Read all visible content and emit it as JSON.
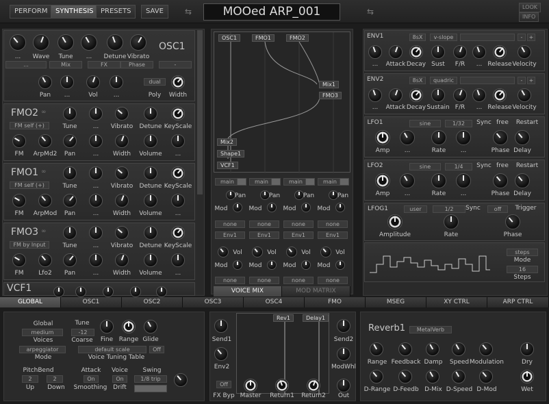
{
  "top": {
    "perform": "PERFORM",
    "synthesis": "SYNTHESIS",
    "presets": "PRESETS",
    "save": "SAVE",
    "preset_name": "MOOed ARP_001",
    "look": "LOOK",
    "info": "INFO"
  },
  "osc1": {
    "title": "OSC1",
    "labels": [
      "...",
      "Wave",
      "Tune",
      "...",
      "Detune",
      "Vibrato"
    ],
    "fields": [
      "...",
      "Mix",
      "FX",
      "Phase",
      "-"
    ],
    "r2": [
      "Pan",
      "...",
      "Vol",
      "...",
      "Poly",
      "Width"
    ],
    "poly": "dual"
  },
  "fmo2": {
    "title": "FMO2",
    "mode": "FM self (+)",
    "r1": [
      "Tune",
      "...",
      "Vibrato",
      "Detune",
      "KeyScale"
    ],
    "r2": [
      "FM",
      "ArpMd2",
      "Pan",
      "...",
      "Width",
      "Volume",
      "..."
    ]
  },
  "fmo1": {
    "title": "FMO1",
    "mode": "FM self (+)",
    "r1": [
      "Tune",
      "...",
      "Vibrato",
      "Detune",
      "KeyScale"
    ],
    "r2": [
      "FM",
      "ArpMod",
      "Pan",
      "...",
      "Width",
      "Volume",
      "..."
    ]
  },
  "fmo3": {
    "title": "FMO3",
    "mode": "FM by Input",
    "r1": [
      "Tune",
      "...",
      "Vibrato",
      "Detune",
      "KeyScale"
    ],
    "r2": [
      "FM",
      "Lfo2",
      "Pan",
      "...",
      "Width",
      "Volume",
      "..."
    ]
  },
  "vcf1": {
    "title": "VCF1"
  },
  "matrix": {
    "top": [
      "OSC1",
      "FMO1",
      "FMO2"
    ],
    "right": [
      "Mix1",
      "FMO3"
    ],
    "left": [
      "Mix2",
      "Shape1",
      "VCF1"
    ],
    "main": [
      "main",
      "main",
      "main",
      "main"
    ],
    "pan": "Pan",
    "mod": "Mod",
    "vol": "Vol",
    "none": "none",
    "env": "Env1",
    "voice_mix": "VOICE MIX",
    "mod_matrix": "MOD MATRIX"
  },
  "env1": {
    "title": "ENV1",
    "rate": "8sX",
    "shape": "v-slope",
    "labels": [
      "...",
      "Attack",
      "Decay",
      "Sust",
      "F/R",
      "...",
      "Release",
      "Velocity"
    ]
  },
  "env2": {
    "title": "ENV2",
    "rate": "8sX",
    "shape": "quadric",
    "labels": [
      "...",
      "Attack",
      "Decay",
      "Sustain",
      "F/R",
      "...",
      "Release",
      "Velocity"
    ]
  },
  "lfo1": {
    "title": "LFO1",
    "wave": "sine",
    "rate": "1/32",
    "sync": "Sync",
    "free": "free",
    "restart": "Restart",
    "labels": [
      "Amp",
      "...",
      "Rate",
      "...",
      "Phase",
      "Delay"
    ]
  },
  "lfo2": {
    "title": "LFO2",
    "wave": "sine",
    "rate": "1/4",
    "sync": "Sync",
    "free": "free",
    "restart": "Restart",
    "labels": [
      "Amp",
      "...",
      "Rate",
      "...",
      "Phase",
      "Delay"
    ]
  },
  "lfog1": {
    "title": "LFOG1",
    "wave": "user",
    "rate": "1/2",
    "sync": "Sync",
    "off": "off",
    "trigger": "Trigger",
    "labels": [
      "Amplitude",
      "Rate",
      "Phase"
    ],
    "steps": "steps",
    "mode": "Mode",
    "steps_val": "16",
    "steps_lbl": "Steps"
  },
  "tabs": [
    "GLOBAL",
    "OSC1",
    "OSC2",
    "OSC3",
    "OSC4",
    "FMO",
    "MSEG",
    "XY CTRL",
    "ARP CTRL"
  ],
  "global": {
    "global": "Global",
    "quality": "medium",
    "voices": "Voices",
    "mode_val": "arpeggiator",
    "mode": "Mode",
    "tune": "Tune",
    "coarse_val": "-12",
    "coarse": "Coarse",
    "fine": "Fine",
    "range": "Range",
    "glide": "Glide",
    "scale": "default scale",
    "off": "Off",
    "vtt": "Voice Tuning Table",
    "pitchbend": "PitchBend",
    "up_val": "2",
    "down_val": "2",
    "up": "Up",
    "down": "Down",
    "attack": "Attack",
    "on1": "On",
    "smoothing": "Smoothing",
    "voice": "Voice",
    "on2": "On",
    "drift": "Drift",
    "swing": "Swing",
    "swing_val": "1/8 trip"
  },
  "fx": {
    "send1": "Send1",
    "env2": "Env2",
    "off": "Off",
    "fxbyp": "FX Byp",
    "master": "Master",
    "return1": "Return1",
    "return2": "Return2",
    "send2": "Send2",
    "modwhl": "ModWhl",
    "out": "Out",
    "rev1": "Rev1",
    "delay1": "Delay1"
  },
  "reverb": {
    "title": "Reverb1",
    "type": "MetalVerb",
    "r1": [
      "Range",
      "Feedback",
      "Damp",
      "Speed",
      "Modulation",
      "Dry"
    ],
    "r2": [
      "D-Range",
      "D-Feedb",
      "D-Mix",
      "D-Speed",
      "D-Mod",
      "Wet"
    ]
  }
}
